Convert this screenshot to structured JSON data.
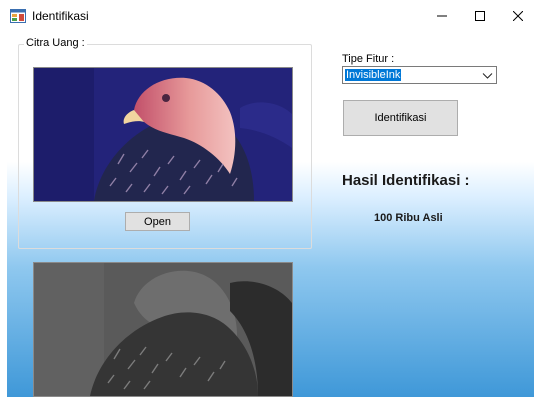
{
  "window": {
    "title": "Identifikasi",
    "icon": "app-form-icon",
    "controls": [
      "minimize-icon",
      "maximize-icon",
      "close-icon"
    ]
  },
  "group": {
    "label": "Citra Uang :"
  },
  "buttons": {
    "open_label": "Open",
    "identify_label": "Identifikasi"
  },
  "fitur": {
    "label": "Tipe Fitur :",
    "selected": "InvisibleInk"
  },
  "hasil": {
    "title": "Hasil Identifikasi :",
    "value": "100 Ribu Asli"
  },
  "colors": {
    "selection": "#0078d7",
    "gradient_bottom": "#3f98d8",
    "button_face": "#e1e1e1",
    "button_border": "#adadad"
  }
}
